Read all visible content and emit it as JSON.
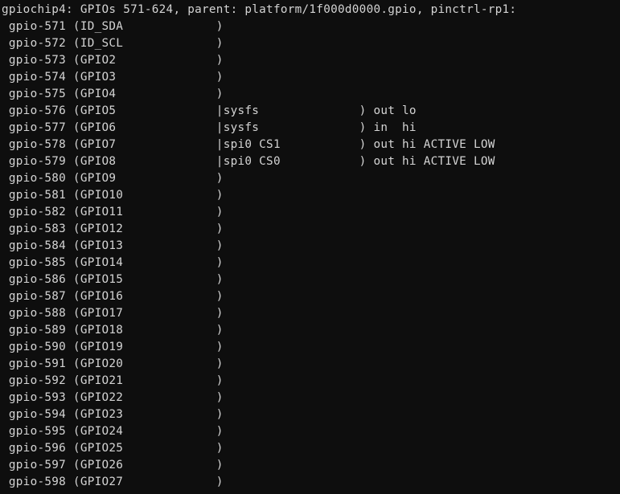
{
  "header": "gpiochip4: GPIOs 571-624, parent: platform/1f000d0000.gpio, pinctrl-rp1:",
  "label_col_width": 19,
  "consumer_col_width": 19,
  "detail_col_width": 8,
  "gpios": [
    {
      "gpio": "gpio-571",
      "label": "ID_SDA",
      "consumer": null,
      "detail": null
    },
    {
      "gpio": "gpio-572",
      "label": "ID_SCL",
      "consumer": null,
      "detail": null
    },
    {
      "gpio": "gpio-573",
      "label": "GPIO2",
      "consumer": null,
      "detail": null
    },
    {
      "gpio": "gpio-574",
      "label": "GPIO3",
      "consumer": null,
      "detail": null
    },
    {
      "gpio": "gpio-575",
      "label": "GPIO4",
      "consumer": null,
      "detail": null
    },
    {
      "gpio": "gpio-576",
      "label": "GPIO5",
      "consumer": "sysfs",
      "detail": "out lo"
    },
    {
      "gpio": "gpio-577",
      "label": "GPIO6",
      "consumer": "sysfs",
      "detail": "in  hi"
    },
    {
      "gpio": "gpio-578",
      "label": "GPIO7",
      "consumer": "spi0 CS1",
      "detail": "out hi ACTIVE LOW"
    },
    {
      "gpio": "gpio-579",
      "label": "GPIO8",
      "consumer": "spi0 CS0",
      "detail": "out hi ACTIVE LOW"
    },
    {
      "gpio": "gpio-580",
      "label": "GPIO9",
      "consumer": null,
      "detail": null
    },
    {
      "gpio": "gpio-581",
      "label": "GPIO10",
      "consumer": null,
      "detail": null
    },
    {
      "gpio": "gpio-582",
      "label": "GPIO11",
      "consumer": null,
      "detail": null
    },
    {
      "gpio": "gpio-583",
      "label": "GPIO12",
      "consumer": null,
      "detail": null
    },
    {
      "gpio": "gpio-584",
      "label": "GPIO13",
      "consumer": null,
      "detail": null
    },
    {
      "gpio": "gpio-585",
      "label": "GPIO14",
      "consumer": null,
      "detail": null
    },
    {
      "gpio": "gpio-586",
      "label": "GPIO15",
      "consumer": null,
      "detail": null
    },
    {
      "gpio": "gpio-587",
      "label": "GPIO16",
      "consumer": null,
      "detail": null
    },
    {
      "gpio": "gpio-588",
      "label": "GPIO17",
      "consumer": null,
      "detail": null
    },
    {
      "gpio": "gpio-589",
      "label": "GPIO18",
      "consumer": null,
      "detail": null
    },
    {
      "gpio": "gpio-590",
      "label": "GPIO19",
      "consumer": null,
      "detail": null
    },
    {
      "gpio": "gpio-591",
      "label": "GPIO20",
      "consumer": null,
      "detail": null
    },
    {
      "gpio": "gpio-592",
      "label": "GPIO21",
      "consumer": null,
      "detail": null
    },
    {
      "gpio": "gpio-593",
      "label": "GPIO22",
      "consumer": null,
      "detail": null
    },
    {
      "gpio": "gpio-594",
      "label": "GPIO23",
      "consumer": null,
      "detail": null
    },
    {
      "gpio": "gpio-595",
      "label": "GPIO24",
      "consumer": null,
      "detail": null
    },
    {
      "gpio": "gpio-596",
      "label": "GPIO25",
      "consumer": null,
      "detail": null
    },
    {
      "gpio": "gpio-597",
      "label": "GPIO26",
      "consumer": null,
      "detail": null
    },
    {
      "gpio": "gpio-598",
      "label": "GPIO27",
      "consumer": null,
      "detail": null
    }
  ]
}
